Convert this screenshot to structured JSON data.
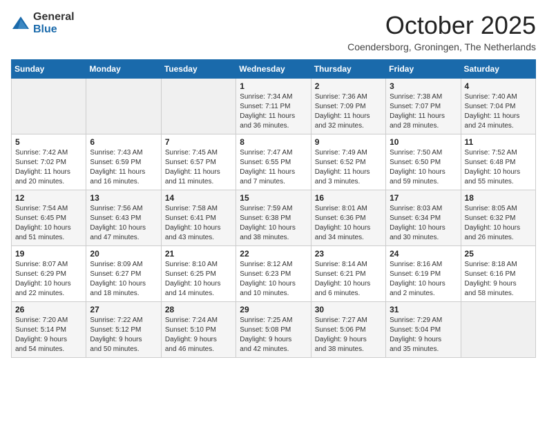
{
  "logo": {
    "general": "General",
    "blue": "Blue"
  },
  "title": "October 2025",
  "location": "Coendersborg, Groningen, The Netherlands",
  "weekdays": [
    "Sunday",
    "Monday",
    "Tuesday",
    "Wednesday",
    "Thursday",
    "Friday",
    "Saturday"
  ],
  "weeks": [
    [
      {
        "day": "",
        "info": ""
      },
      {
        "day": "",
        "info": ""
      },
      {
        "day": "",
        "info": ""
      },
      {
        "day": "1",
        "info": "Sunrise: 7:34 AM\nSunset: 7:11 PM\nDaylight: 11 hours\nand 36 minutes."
      },
      {
        "day": "2",
        "info": "Sunrise: 7:36 AM\nSunset: 7:09 PM\nDaylight: 11 hours\nand 32 minutes."
      },
      {
        "day": "3",
        "info": "Sunrise: 7:38 AM\nSunset: 7:07 PM\nDaylight: 11 hours\nand 28 minutes."
      },
      {
        "day": "4",
        "info": "Sunrise: 7:40 AM\nSunset: 7:04 PM\nDaylight: 11 hours\nand 24 minutes."
      }
    ],
    [
      {
        "day": "5",
        "info": "Sunrise: 7:42 AM\nSunset: 7:02 PM\nDaylight: 11 hours\nand 20 minutes."
      },
      {
        "day": "6",
        "info": "Sunrise: 7:43 AM\nSunset: 6:59 PM\nDaylight: 11 hours\nand 16 minutes."
      },
      {
        "day": "7",
        "info": "Sunrise: 7:45 AM\nSunset: 6:57 PM\nDaylight: 11 hours\nand 11 minutes."
      },
      {
        "day": "8",
        "info": "Sunrise: 7:47 AM\nSunset: 6:55 PM\nDaylight: 11 hours\nand 7 minutes."
      },
      {
        "day": "9",
        "info": "Sunrise: 7:49 AM\nSunset: 6:52 PM\nDaylight: 11 hours\nand 3 minutes."
      },
      {
        "day": "10",
        "info": "Sunrise: 7:50 AM\nSunset: 6:50 PM\nDaylight: 10 hours\nand 59 minutes."
      },
      {
        "day": "11",
        "info": "Sunrise: 7:52 AM\nSunset: 6:48 PM\nDaylight: 10 hours\nand 55 minutes."
      }
    ],
    [
      {
        "day": "12",
        "info": "Sunrise: 7:54 AM\nSunset: 6:45 PM\nDaylight: 10 hours\nand 51 minutes."
      },
      {
        "day": "13",
        "info": "Sunrise: 7:56 AM\nSunset: 6:43 PM\nDaylight: 10 hours\nand 47 minutes."
      },
      {
        "day": "14",
        "info": "Sunrise: 7:58 AM\nSunset: 6:41 PM\nDaylight: 10 hours\nand 43 minutes."
      },
      {
        "day": "15",
        "info": "Sunrise: 7:59 AM\nSunset: 6:38 PM\nDaylight: 10 hours\nand 38 minutes."
      },
      {
        "day": "16",
        "info": "Sunrise: 8:01 AM\nSunset: 6:36 PM\nDaylight: 10 hours\nand 34 minutes."
      },
      {
        "day": "17",
        "info": "Sunrise: 8:03 AM\nSunset: 6:34 PM\nDaylight: 10 hours\nand 30 minutes."
      },
      {
        "day": "18",
        "info": "Sunrise: 8:05 AM\nSunset: 6:32 PM\nDaylight: 10 hours\nand 26 minutes."
      }
    ],
    [
      {
        "day": "19",
        "info": "Sunrise: 8:07 AM\nSunset: 6:29 PM\nDaylight: 10 hours\nand 22 minutes."
      },
      {
        "day": "20",
        "info": "Sunrise: 8:09 AM\nSunset: 6:27 PM\nDaylight: 10 hours\nand 18 minutes."
      },
      {
        "day": "21",
        "info": "Sunrise: 8:10 AM\nSunset: 6:25 PM\nDaylight: 10 hours\nand 14 minutes."
      },
      {
        "day": "22",
        "info": "Sunrise: 8:12 AM\nSunset: 6:23 PM\nDaylight: 10 hours\nand 10 minutes."
      },
      {
        "day": "23",
        "info": "Sunrise: 8:14 AM\nSunset: 6:21 PM\nDaylight: 10 hours\nand 6 minutes."
      },
      {
        "day": "24",
        "info": "Sunrise: 8:16 AM\nSunset: 6:19 PM\nDaylight: 10 hours\nand 2 minutes."
      },
      {
        "day": "25",
        "info": "Sunrise: 8:18 AM\nSunset: 6:16 PM\nDaylight: 9 hours\nand 58 minutes."
      }
    ],
    [
      {
        "day": "26",
        "info": "Sunrise: 7:20 AM\nSunset: 5:14 PM\nDaylight: 9 hours\nand 54 minutes."
      },
      {
        "day": "27",
        "info": "Sunrise: 7:22 AM\nSunset: 5:12 PM\nDaylight: 9 hours\nand 50 minutes."
      },
      {
        "day": "28",
        "info": "Sunrise: 7:24 AM\nSunset: 5:10 PM\nDaylight: 9 hours\nand 46 minutes."
      },
      {
        "day": "29",
        "info": "Sunrise: 7:25 AM\nSunset: 5:08 PM\nDaylight: 9 hours\nand 42 minutes."
      },
      {
        "day": "30",
        "info": "Sunrise: 7:27 AM\nSunset: 5:06 PM\nDaylight: 9 hours\nand 38 minutes."
      },
      {
        "day": "31",
        "info": "Sunrise: 7:29 AM\nSunset: 5:04 PM\nDaylight: 9 hours\nand 35 minutes."
      },
      {
        "day": "",
        "info": ""
      }
    ]
  ]
}
